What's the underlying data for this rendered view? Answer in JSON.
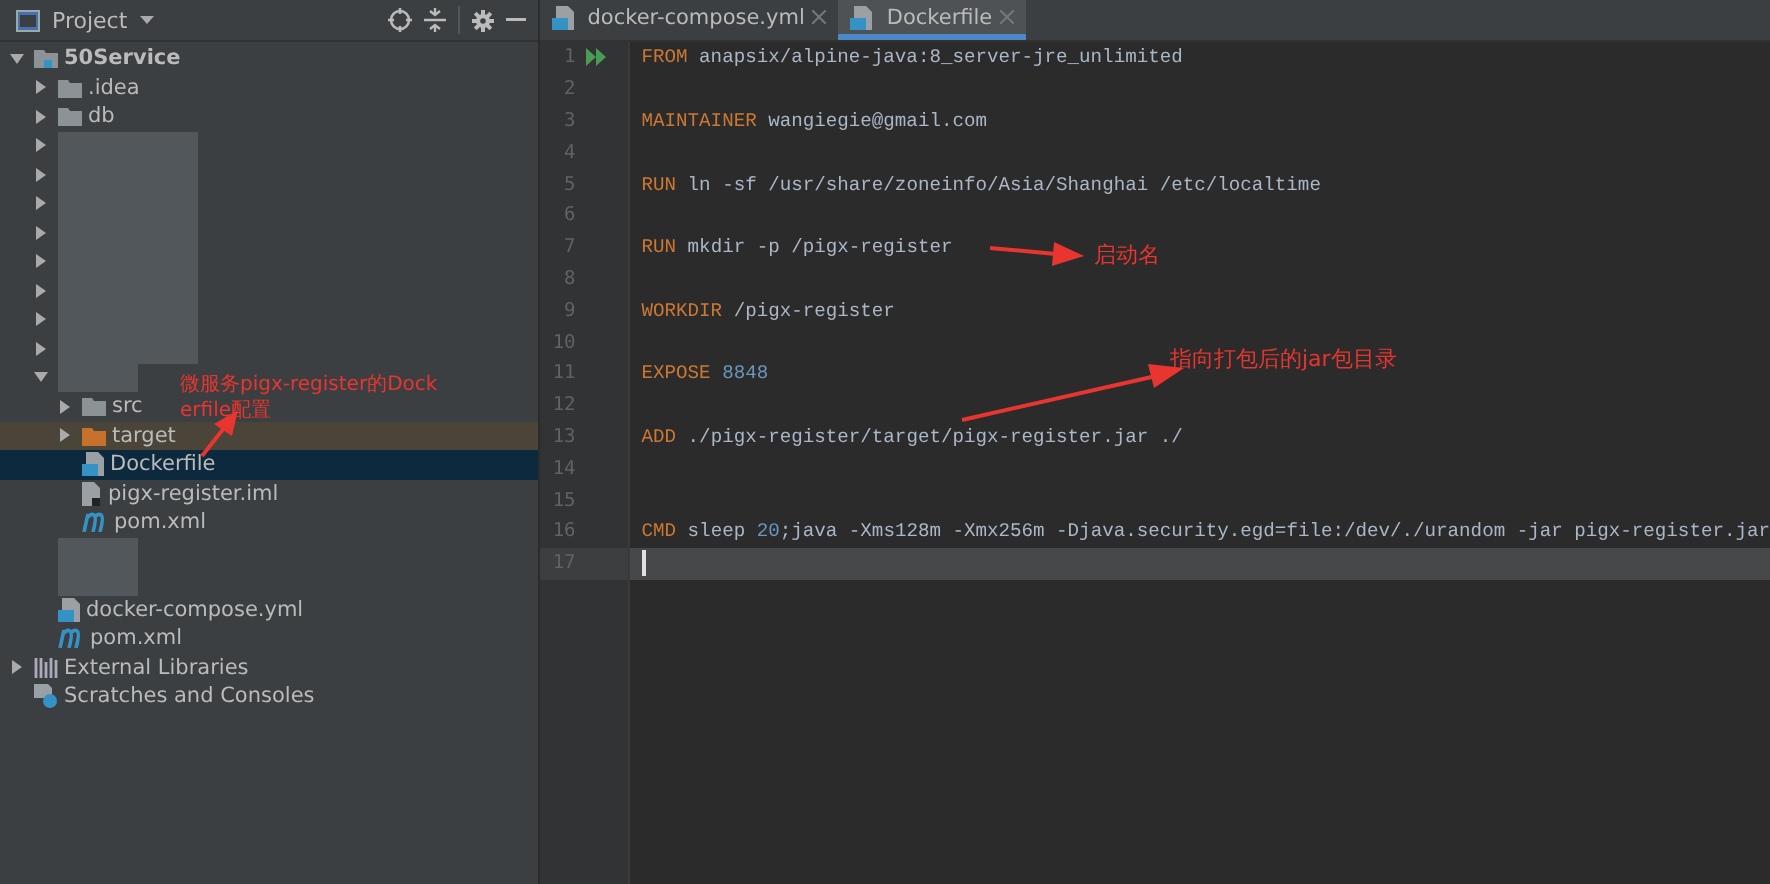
{
  "project_panel": {
    "title": "Project",
    "tree": [
      {
        "kind": "module",
        "label": "50Service",
        "expanded": true,
        "selected": false,
        "excluded": false,
        "children": [
          {
            "kind": "folder",
            "label": ".idea",
            "expanded": false,
            "selected": false,
            "excluded": false
          },
          {
            "kind": "folder",
            "label": "db",
            "expanded": false,
            "selected": false,
            "excluded": false
          },
          {
            "kind": "redacted",
            "expanded": false,
            "selected": false,
            "excluded": false
          },
          {
            "kind": "redacted",
            "expanded": false,
            "selected": false,
            "excluded": false
          },
          {
            "kind": "redacted",
            "expanded": false,
            "selected": false,
            "excluded": false
          },
          {
            "kind": "redacted",
            "expanded": false,
            "selected": false,
            "excluded": false
          },
          {
            "kind": "redacted",
            "expanded": false,
            "selected": false,
            "excluded": false
          },
          {
            "kind": "redacted",
            "expanded": false,
            "selected": false,
            "excluded": false
          },
          {
            "kind": "redacted",
            "expanded": false,
            "selected": false,
            "excluded": false
          },
          {
            "kind": "redacted",
            "expanded": false,
            "selected": false,
            "excluded": false
          },
          {
            "kind": "redacted",
            "expanded": true,
            "selected": false,
            "excluded": false,
            "children": [
              {
                "kind": "folder",
                "label": "src",
                "expanded": false,
                "selected": false,
                "excluded": false
              },
              {
                "kind": "folder",
                "label": "target",
                "expanded": false,
                "selected": false,
                "excluded": true
              },
              {
                "kind": "docker",
                "label": "Dockerfile",
                "selected": true,
                "excluded": false
              },
              {
                "kind": "iml",
                "label": "pigx-register.iml",
                "selected": false,
                "excluded": false
              },
              {
                "kind": "maven",
                "label": "pom.xml",
                "selected": false,
                "excluded": false
              }
            ]
          },
          {
            "kind": "redacted",
            "selected": false,
            "excluded": false
          },
          {
            "kind": "redacted",
            "selected": false,
            "excluded": false
          },
          {
            "kind": "docker",
            "label": "docker-compose.yml",
            "selected": false,
            "excluded": false
          },
          {
            "kind": "maven",
            "label": "pom.xml",
            "selected": false,
            "excluded": false
          }
        ]
      },
      {
        "kind": "libraries",
        "label": "External Libraries",
        "expanded": false,
        "selected": false,
        "excluded": false
      },
      {
        "kind": "scratches",
        "label": "Scratches and Consoles",
        "selected": false,
        "excluded": false
      }
    ]
  },
  "tabs": [
    {
      "label": "docker-compose.yml",
      "selected": false
    },
    {
      "label": "Dockerfile",
      "selected": true
    }
  ],
  "editor": {
    "lines": [
      {
        "number": "1",
        "run": true,
        "current": false,
        "tokens": [
          {
            "kind": "keyword",
            "text": "FROM"
          },
          {
            "kind": "plain",
            "text": " anapsix/alpine-java:8_server-jre_unlimited"
          }
        ]
      },
      {
        "number": "2",
        "run": false,
        "current": false
      },
      {
        "number": "3",
        "run": false,
        "current": false,
        "tokens": [
          {
            "kind": "keyword",
            "text": "MAINTAINER"
          },
          {
            "kind": "plain",
            "text": " wangiegie@gmail.com"
          }
        ]
      },
      {
        "number": "4",
        "run": false,
        "current": false
      },
      {
        "number": "5",
        "run": false,
        "current": false,
        "tokens": [
          {
            "kind": "keyword",
            "text": "RUN"
          },
          {
            "kind": "plain",
            "text": " ln -sf /usr/share/zoneinfo/Asia/Shanghai /etc/localtime"
          }
        ]
      },
      {
        "number": "6",
        "run": false,
        "current": false
      },
      {
        "number": "7",
        "run": false,
        "current": false,
        "tokens": [
          {
            "kind": "keyword",
            "text": "RUN"
          },
          {
            "kind": "plain",
            "text": " mkdir -p /pigx-register"
          }
        ]
      },
      {
        "number": "8",
        "run": false,
        "current": false
      },
      {
        "number": "9",
        "run": false,
        "current": false,
        "tokens": [
          {
            "kind": "keyword",
            "text": "WORKDIR"
          },
          {
            "kind": "plain",
            "text": " /pigx-register"
          }
        ]
      },
      {
        "number": "10",
        "run": false,
        "current": false
      },
      {
        "number": "11",
        "run": false,
        "current": false,
        "tokens": [
          {
            "kind": "keyword",
            "text": "EXPOSE"
          },
          {
            "kind": "number",
            "text": "8848"
          }
        ]
      },
      {
        "number": "12",
        "run": false,
        "current": false
      },
      {
        "number": "13",
        "run": false,
        "current": false,
        "tokens": [
          {
            "kind": "keyword",
            "text": "ADD"
          },
          {
            "kind": "plain",
            "text": " ./pigx-register/target/pigx-register.jar ./"
          }
        ]
      },
      {
        "number": "14",
        "run": false,
        "current": false
      },
      {
        "number": "15",
        "run": false,
        "current": false
      },
      {
        "number": "16",
        "run": false,
        "current": false,
        "tokens": [
          {
            "kind": "keyword",
            "text": "CMD"
          },
          {
            "kind": "plain",
            "text": " sleep "
          },
          {
            "kind": "number",
            "text": "20"
          },
          {
            "kind": "plain",
            "text": ";java -Xms128m -Xmx256m -Djava.security.egd=file:/dev/./urandom -jar pigx-register.jar"
          }
        ]
      },
      {
        "number": "17",
        "run": false,
        "current": true
      }
    ]
  },
  "annotations": [
    "启动名",
    "指向打包后的jar包目录",
    "微服务pigx-register的Dockerfile配置"
  ]
}
